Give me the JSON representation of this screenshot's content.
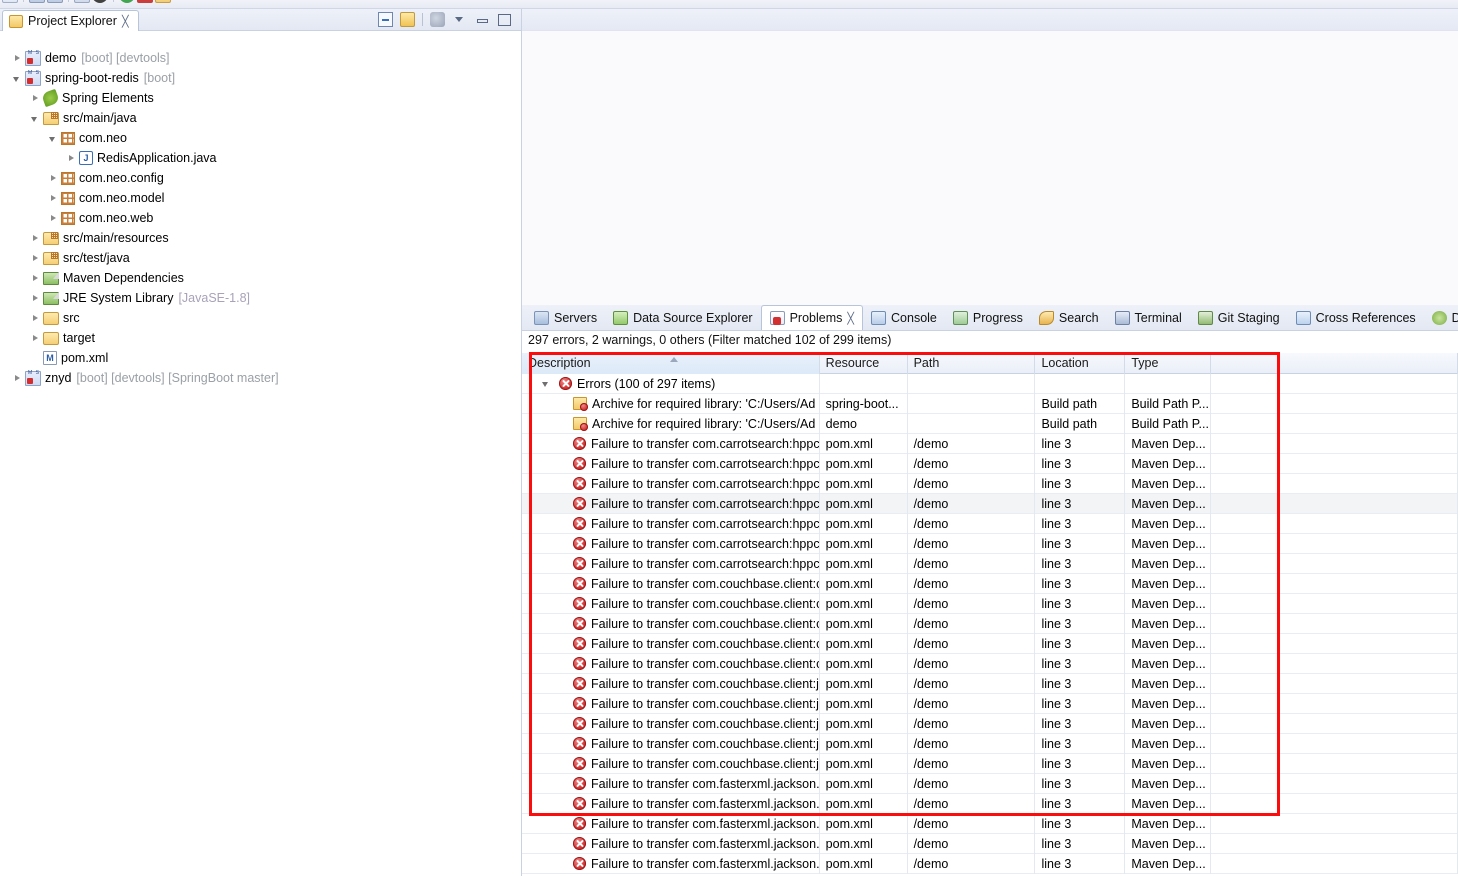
{
  "toolbar": {
    "visible": true
  },
  "explorer": {
    "tab_label": "Project Explorer",
    "close_glyph": "╳",
    "tools": [
      "collapse-all-icon",
      "link-with-editor-icon",
      "view-menu-icon",
      "minimize-icon",
      "maximize-icon"
    ],
    "tree": [
      {
        "depth": 0,
        "arrow": "closed",
        "icon": "project-icon",
        "label": "demo",
        "dim": "[boot] [devtools]"
      },
      {
        "depth": 0,
        "arrow": "open",
        "icon": "project-icon",
        "label": "spring-boot-redis",
        "dim": "[boot]"
      },
      {
        "depth": 1,
        "arrow": "closed",
        "icon": "spring-icon",
        "label": "Spring Elements",
        "dim": ""
      },
      {
        "depth": 1,
        "arrow": "open",
        "icon": "source-folder-icon",
        "label": "src/main/java",
        "dim": ""
      },
      {
        "depth": 2,
        "arrow": "open",
        "icon": "package-icon",
        "label": "com.neo",
        "dim": ""
      },
      {
        "depth": 3,
        "arrow": "closed",
        "icon": "java-file-icon",
        "label": "RedisApplication.java",
        "dim": ""
      },
      {
        "depth": 2,
        "arrow": "closed",
        "icon": "package-icon",
        "label": "com.neo.config",
        "dim": ""
      },
      {
        "depth": 2,
        "arrow": "closed",
        "icon": "package-icon",
        "label": "com.neo.model",
        "dim": ""
      },
      {
        "depth": 2,
        "arrow": "closed",
        "icon": "package-icon",
        "label": "com.neo.web",
        "dim": ""
      },
      {
        "depth": 1,
        "arrow": "closed",
        "icon": "source-folder-icon",
        "label": "src/main/resources",
        "dim": ""
      },
      {
        "depth": 1,
        "arrow": "closed",
        "icon": "source-folder-icon",
        "label": "src/test/java",
        "dim": ""
      },
      {
        "depth": 1,
        "arrow": "closed",
        "icon": "library-icon",
        "label": "Maven Dependencies",
        "dim": ""
      },
      {
        "depth": 1,
        "arrow": "closed",
        "icon": "library-icon",
        "label": "JRE System Library",
        "dim": "[JavaSE-1.8]"
      },
      {
        "depth": 1,
        "arrow": "closed",
        "icon": "folder-icon",
        "label": "src",
        "dim": ""
      },
      {
        "depth": 1,
        "arrow": "closed",
        "icon": "folder-icon",
        "label": "target",
        "dim": ""
      },
      {
        "depth": 1,
        "arrow": "none",
        "icon": "xml-file-icon",
        "label": "pom.xml",
        "dim": ""
      },
      {
        "depth": 0,
        "arrow": "closed",
        "icon": "project-icon",
        "label": "znyd",
        "dim": "[boot] [devtools] [SpringBoot master]"
      }
    ]
  },
  "problems": {
    "tabs": [
      {
        "label": "Servers",
        "icon": "servers-icon",
        "active": false
      },
      {
        "label": "Data Source Explorer",
        "icon": "datasource-icon",
        "active": false
      },
      {
        "label": "Problems",
        "icon": "problems-icon",
        "active": true,
        "close_glyph": "╳"
      },
      {
        "label": "Console",
        "icon": "console-icon",
        "active": false
      },
      {
        "label": "Progress",
        "icon": "progress-icon",
        "active": false
      },
      {
        "label": "Search",
        "icon": "search-icon",
        "active": false
      },
      {
        "label": "Terminal",
        "icon": "terminal-icon",
        "active": false
      },
      {
        "label": "Git Staging",
        "icon": "git-icon",
        "active": false
      },
      {
        "label": "Cross References",
        "icon": "xref-icon",
        "active": false
      },
      {
        "label": "Debug",
        "icon": "debug-icon",
        "active": false
      }
    ],
    "status": "297 errors, 2 warnings, 0 others (Filter matched 102 of 299 items)",
    "columns": [
      "Description",
      "Resource",
      "Path",
      "Location",
      "Type",
      ""
    ],
    "group_row": {
      "label": "Errors (100 of 297 items)",
      "icon": "error-icon",
      "expanded": true
    },
    "rows": [
      {
        "icon": "build-path-icon",
        "description": "Archive for required library: 'C:/Users/Ad",
        "resource": "spring-boot...",
        "path": "",
        "location": "Build path",
        "type": "Build Path P...",
        "alt": false
      },
      {
        "icon": "build-path-icon",
        "description": "Archive for required library: 'C:/Users/Ad",
        "resource": "demo",
        "path": "",
        "location": "Build path",
        "type": "Build Path P...",
        "alt": false
      },
      {
        "icon": "error-icon",
        "description": "Failure to transfer com.carrotsearch:hppc",
        "resource": "pom.xml",
        "path": "/demo",
        "location": "line 3",
        "type": "Maven Dep...",
        "alt": false
      },
      {
        "icon": "error-icon",
        "description": "Failure to transfer com.carrotsearch:hppc",
        "resource": "pom.xml",
        "path": "/demo",
        "location": "line 3",
        "type": "Maven Dep...",
        "alt": false
      },
      {
        "icon": "error-icon",
        "description": "Failure to transfer com.carrotsearch:hppc",
        "resource": "pom.xml",
        "path": "/demo",
        "location": "line 3",
        "type": "Maven Dep...",
        "alt": false
      },
      {
        "icon": "error-icon",
        "description": "Failure to transfer com.carrotsearch:hppc",
        "resource": "pom.xml",
        "path": "/demo",
        "location": "line 3",
        "type": "Maven Dep...",
        "alt": true
      },
      {
        "icon": "error-icon",
        "description": "Failure to transfer com.carrotsearch:hppc",
        "resource": "pom.xml",
        "path": "/demo",
        "location": "line 3",
        "type": "Maven Dep...",
        "alt": false
      },
      {
        "icon": "error-icon",
        "description": "Failure to transfer com.carrotsearch:hppc",
        "resource": "pom.xml",
        "path": "/demo",
        "location": "line 3",
        "type": "Maven Dep...",
        "alt": false
      },
      {
        "icon": "error-icon",
        "description": "Failure to transfer com.carrotsearch:hppc",
        "resource": "pom.xml",
        "path": "/demo",
        "location": "line 3",
        "type": "Maven Dep...",
        "alt": false
      },
      {
        "icon": "error-icon",
        "description": "Failure to transfer com.couchbase.client:c",
        "resource": "pom.xml",
        "path": "/demo",
        "location": "line 3",
        "type": "Maven Dep...",
        "alt": false
      },
      {
        "icon": "error-icon",
        "description": "Failure to transfer com.couchbase.client:c",
        "resource": "pom.xml",
        "path": "/demo",
        "location": "line 3",
        "type": "Maven Dep...",
        "alt": false
      },
      {
        "icon": "error-icon",
        "description": "Failure to transfer com.couchbase.client:c",
        "resource": "pom.xml",
        "path": "/demo",
        "location": "line 3",
        "type": "Maven Dep...",
        "alt": false
      },
      {
        "icon": "error-icon",
        "description": "Failure to transfer com.couchbase.client:c",
        "resource": "pom.xml",
        "path": "/demo",
        "location": "line 3",
        "type": "Maven Dep...",
        "alt": false
      },
      {
        "icon": "error-icon",
        "description": "Failure to transfer com.couchbase.client:c",
        "resource": "pom.xml",
        "path": "/demo",
        "location": "line 3",
        "type": "Maven Dep...",
        "alt": false
      },
      {
        "icon": "error-icon",
        "description": "Failure to transfer com.couchbase.client:j",
        "resource": "pom.xml",
        "path": "/demo",
        "location": "line 3",
        "type": "Maven Dep...",
        "alt": false
      },
      {
        "icon": "error-icon",
        "description": "Failure to transfer com.couchbase.client:j",
        "resource": "pom.xml",
        "path": "/demo",
        "location": "line 3",
        "type": "Maven Dep...",
        "alt": false
      },
      {
        "icon": "error-icon",
        "description": "Failure to transfer com.couchbase.client:j",
        "resource": "pom.xml",
        "path": "/demo",
        "location": "line 3",
        "type": "Maven Dep...",
        "alt": false
      },
      {
        "icon": "error-icon",
        "description": "Failure to transfer com.couchbase.client:j",
        "resource": "pom.xml",
        "path": "/demo",
        "location": "line 3",
        "type": "Maven Dep...",
        "alt": false
      },
      {
        "icon": "error-icon",
        "description": "Failure to transfer com.couchbase.client:j",
        "resource": "pom.xml",
        "path": "/demo",
        "location": "line 3",
        "type": "Maven Dep...",
        "alt": false
      },
      {
        "icon": "error-icon",
        "description": "Failure to transfer com.fasterxml.jackson.",
        "resource": "pom.xml",
        "path": "/demo",
        "location": "line 3",
        "type": "Maven Dep...",
        "alt": false
      },
      {
        "icon": "error-icon",
        "description": "Failure to transfer com.fasterxml.jackson.",
        "resource": "pom.xml",
        "path": "/demo",
        "location": "line 3",
        "type": "Maven Dep...",
        "alt": false
      },
      {
        "icon": "error-icon",
        "description": "Failure to transfer com.fasterxml.jackson.",
        "resource": "pom.xml",
        "path": "/demo",
        "location": "line 3",
        "type": "Maven Dep...",
        "alt": false
      },
      {
        "icon": "error-icon",
        "description": "Failure to transfer com.fasterxml.jackson.",
        "resource": "pom.xml",
        "path": "/demo",
        "location": "line 3",
        "type": "Maven Dep...",
        "alt": false
      },
      {
        "icon": "error-icon",
        "description": "Failure to transfer com.fasterxml.jackson.",
        "resource": "pom.xml",
        "path": "/demo",
        "location": "line 3",
        "type": "Maven Dep...",
        "alt": false
      }
    ]
  },
  "annotation": {
    "color": "#fb0d0d",
    "shape": "rectangle"
  }
}
